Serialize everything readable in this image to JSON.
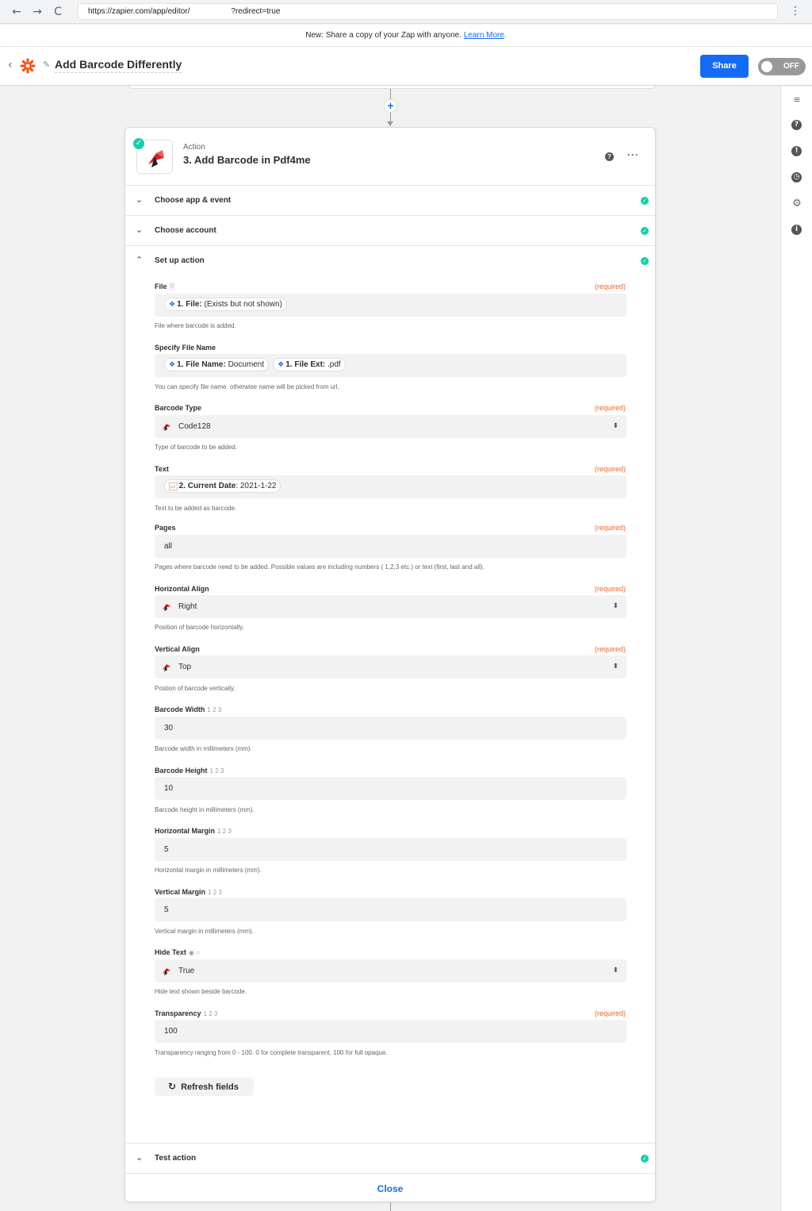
{
  "browser": {
    "url": "https://zapier.com/app/editor/",
    "url_suffix": "?redirect=true",
    "back": "←",
    "forward": "→",
    "reload": "C",
    "menu": "⋮"
  },
  "banner": {
    "text": "New: Share a copy of your Zap with anyone. ",
    "link": "Learn More",
    "tail": "."
  },
  "header": {
    "back": "‹",
    "zap_title": "Add Barcode Differently",
    "share_label": "Share",
    "toggle_label": "OFF",
    "pencil": "✎"
  },
  "colors": {
    "brand_orange": "#ff4a00",
    "primary_blue": "#136bf5",
    "success_green": "#13d0ab",
    "required_orange": "#e8672f",
    "pdf4me_red": "#d42027"
  },
  "step": {
    "kind": "Action",
    "title": "3. Add Barcode in Pdf4me",
    "help": "?",
    "more": "···",
    "check": "✓"
  },
  "sections": {
    "choose_app": "Choose app & event",
    "choose_account": "Choose account",
    "setup_action": "Set up action",
    "test_action": "Test action",
    "ok": "✓",
    "chev_down": "⌄",
    "chev_up": "⌃"
  },
  "required": "(required)",
  "fields": {
    "file": {
      "label": "File",
      "hint": "🗎",
      "pill_prefix": "1. File:",
      "pill_value": "(Exists but not shown)",
      "help": "File where barcode is added."
    },
    "file_name": {
      "label": "Specify File Name",
      "pill1_prefix": "1. File Name:",
      "pill1_value": "Document",
      "pill2_prefix": "1. File Ext:",
      "pill2_value": ".pdf",
      "help": "You can specify file name. otherwise name will be picked from url."
    },
    "barcode_type": {
      "label": "Barcode Type",
      "value": "Code128",
      "help": "Type of barcode to be added."
    },
    "text": {
      "label": "Text",
      "pill_prefix": "2. Current Date",
      "pill_value": ": 2021-1-22",
      "help": "Text to be added as barcode."
    },
    "pages": {
      "label": "Pages",
      "value": "all",
      "help": "Pages where barcode need to be added. Possible values are including numbers ( 1,2,3 etc.) or text (first, last and all)."
    },
    "horizontal_align": {
      "label": "Horizontal Align",
      "value": "Right",
      "help": "Position of barcode horizontally."
    },
    "vertical_align": {
      "label": "Vertical Align",
      "value": "Top",
      "help": "Postion of barcode vertically."
    },
    "barcode_width": {
      "label": "Barcode Width",
      "hint": "1 2 3",
      "value": "30",
      "help": "Barcode width in millimeters (mm)."
    },
    "barcode_height": {
      "label": "Barcode Height",
      "hint": "1 2 3",
      "value": "10",
      "help": "Barcode height in millimeters (mm)."
    },
    "horizontal_margin": {
      "label": "Horizontal Margin",
      "hint": "1 2 3",
      "value": "5",
      "help": "Horizontal margin in millimeters (mm)."
    },
    "vertical_margin": {
      "label": "Vertical Margin",
      "hint": "1 2 3",
      "value": "5",
      "help": "Vertical margin in millimeters (mm)."
    },
    "hide_text": {
      "label": "Hide Text",
      "hint": "◉ ○",
      "value": "True",
      "help": "Hide text shown beside barcode."
    },
    "transparency": {
      "label": "Transparency",
      "hint": "1 2 3",
      "value": "100",
      "help": "Transparency ranging from 0 - 100. 0 for complete transparent, 100 for full opaque."
    }
  },
  "refresh_label": "Refresh fields",
  "refresh_icon": "↻",
  "close_label": "Close",
  "icons": {
    "plus": "+",
    "updown": "⬍",
    "dropbox": "❖",
    "calendar": "▭"
  },
  "rail": {
    "outline": "≡",
    "help": "?",
    "alert": "!",
    "history": "◷",
    "settings": "⚙",
    "info": "i"
  }
}
